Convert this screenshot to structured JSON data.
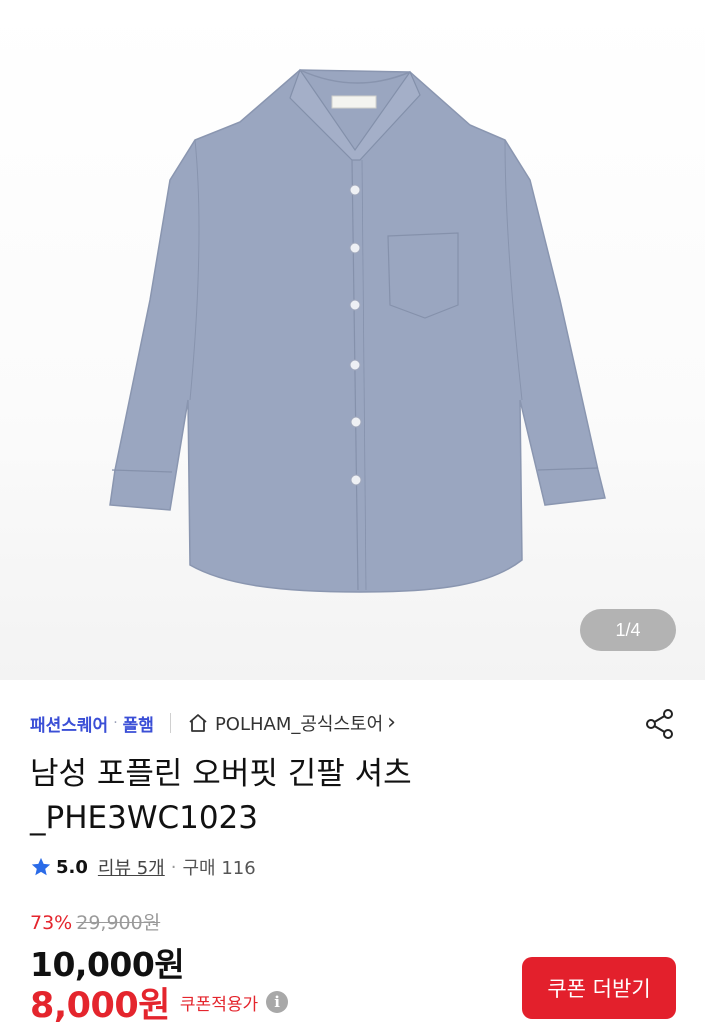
{
  "gallery": {
    "current": 1,
    "total": 4,
    "pager_text": "1/4",
    "image_icon": "blue-long-sleeve-shirt",
    "shirt_color": "#9aa6c0"
  },
  "store": {
    "tag": "패션스퀘어",
    "brand": "폴햄",
    "store_name": "POLHAM_공식스토어",
    "home_icon": "home-icon",
    "chevron": "›",
    "share_icon": "share-icon"
  },
  "product": {
    "title_line1": "남성 포플린 오버핏 긴팔 셔츠",
    "title_line2": "_PHE3WC1023"
  },
  "rating": {
    "star_icon": "star-icon",
    "score": "5.0",
    "reviews": "리뷰 5개",
    "purchases": "구매 116"
  },
  "price": {
    "discount_rate": "73%",
    "original": "29,900원",
    "sale": "10,000원",
    "coupon_price": "8,000원",
    "coupon_note": "쿠폰적용가",
    "info_icon": "info-icon"
  },
  "coupon_button": {
    "label": "쿠폰 더받기"
  },
  "colors": {
    "accent_red": "#e3202c",
    "brand_blue": "#3b4fd6"
  }
}
